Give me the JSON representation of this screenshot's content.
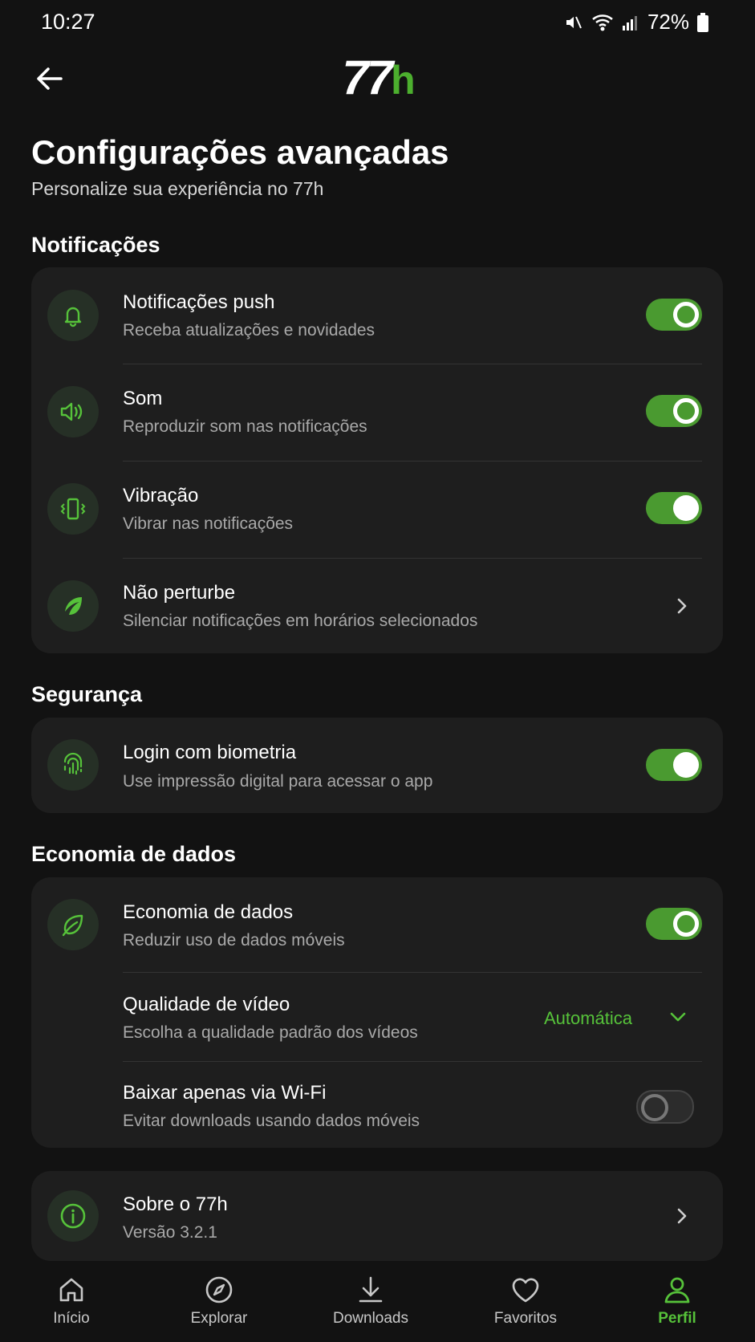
{
  "status_bar": {
    "time": "10:27",
    "battery": "72%"
  },
  "header": {
    "logo_main": "77",
    "logo_accent": "h"
  },
  "page": {
    "title": "Configurações avançadas",
    "subtitle": "Personalize sua experiência no 77h"
  },
  "notifications": {
    "section_title": "Notificações",
    "items": [
      {
        "title": "Notificações push",
        "desc": "Receba atualizações e novidades",
        "icon": "bell-icon",
        "enabled": true
      },
      {
        "title": "Som",
        "desc": "Reproduzir som nas notificações",
        "icon": "speaker-icon",
        "enabled": true
      },
      {
        "title": "Vibração",
        "desc": "Vibrar nas notificações",
        "icon": "vibration-icon",
        "enabled": true
      },
      {
        "title": "Não perturbe",
        "desc": "Silenciar notificações em horários selecionados",
        "icon": "do-not-disturb-icon"
      }
    ]
  },
  "security": {
    "section_title": "Segurança",
    "items": [
      {
        "title": "Login com biometria",
        "desc": "Use impressão digital para acessar o app",
        "icon": "fingerprint-icon",
        "enabled": true
      }
    ]
  },
  "data_saving": {
    "section_title": "Economia de dados",
    "items": [
      {
        "title": "Economia de dados",
        "desc": "Reduzir uso de dados móveis",
        "icon": "leaf-icon",
        "enabled": true
      },
      {
        "title": "Qualidade de vídeo",
        "desc": "Escolha a qualidade padrão dos vídeos",
        "selected": "Automática"
      },
      {
        "title": "Baixar apenas via Wi-Fi",
        "desc": "Evitar downloads usando dados móveis",
        "enabled": false
      }
    ]
  },
  "about": {
    "title": "Sobre o 77h",
    "version": "Versão 3.2.1",
    "icon": "info-icon"
  },
  "bottom_nav": {
    "items": [
      {
        "label": "Início",
        "icon": "home-icon"
      },
      {
        "label": "Explorar",
        "icon": "compass-icon"
      },
      {
        "label": "Downloads",
        "icon": "download-icon"
      },
      {
        "label": "Favoritos",
        "icon": "heart-icon"
      },
      {
        "label": "Perfil",
        "icon": "profile-icon",
        "active": true
      }
    ]
  },
  "colors": {
    "accent": "#4caf2e",
    "background": "#121212",
    "card": "#1e1e1e"
  }
}
